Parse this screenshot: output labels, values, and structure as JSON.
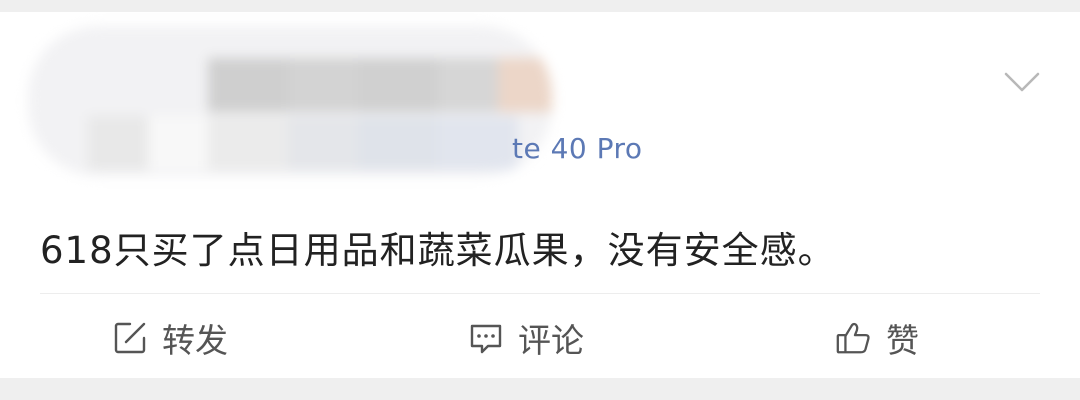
{
  "post": {
    "source_text": "te 40 Pro",
    "body_text": "618只买了点日用品和蔬菜瓜果，没有安全感。"
  },
  "actions": {
    "repost_label": "转发",
    "comment_label": "评论",
    "like_label": "赞"
  },
  "icons": {
    "menu": "chevron-down-icon",
    "repost": "edit-square-icon",
    "comment": "comment-bubble-icon",
    "like": "thumbs-up-icon"
  },
  "colors": {
    "accent_link": "#5c79b5",
    "text_primary": "#222222",
    "text_secondary": "#555555",
    "background": "#efefef",
    "card": "#ffffff"
  }
}
